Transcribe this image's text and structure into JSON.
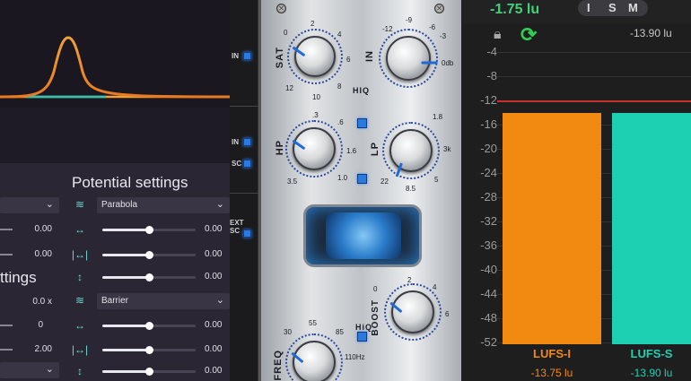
{
  "left": {
    "potential_heading": "Potential settings",
    "settings_heading": "ttings",
    "rows": [
      {
        "left_val": "",
        "select": "Parabola"
      },
      {
        "left_val": "0.00",
        "right_val": "0.00",
        "icon": "arrows-out-icon",
        "slider": 0.55
      },
      {
        "left_val": "0.00",
        "right_val": "0.00",
        "icon": "bracket-arrows-icon",
        "slider": 0.55
      },
      {
        "right_val": "0.00",
        "icon": "vertical-arrows-icon",
        "slider": 0.55
      }
    ],
    "rows2": [
      {
        "left_val": "0.0 x",
        "select": "Barrier"
      },
      {
        "left_val": "0",
        "right_val": "0.00",
        "icon": "arrows-out-icon",
        "slider": 0.55
      },
      {
        "left_val": "2.00",
        "right_val": "0.00",
        "icon": "bracket-arrows-icon",
        "slider": 0.55
      },
      {
        "right_val": "0.00",
        "icon": "vertical-arrows-icon",
        "slider": 0.55
      }
    ],
    "curve_colors": {
      "peak": "#f2a038",
      "base": "#2cc6b8"
    }
  },
  "mid": {
    "strip": [
      "IN",
      "IN",
      "SC",
      "EXT SC"
    ],
    "knobs": {
      "sat": {
        "label": "SAT",
        "ticks": [
          "2",
          "4",
          "6",
          "8",
          "10",
          "12",
          "0"
        ]
      },
      "in": {
        "label": "IN",
        "ticks": [
          "-9",
          "-6",
          "-3",
          "0db",
          "-12"
        ]
      },
      "hp": {
        "label": "HP",
        "ticks": [
          ".3",
          ".6",
          "1.0",
          "1.6",
          "2.6",
          "3.5",
          " .18"
        ]
      },
      "lp": {
        "label": "LP",
        "ticks": [
          "1.8",
          "3k",
          "5",
          "8.5",
          "22",
          "11",
          "6.85"
        ]
      },
      "boost": {
        "label": "BOOST",
        "ticks": [
          "0",
          "2",
          "4",
          "6"
        ]
      },
      "freq": {
        "label": "FREQ",
        "ticks": [
          "55",
          "85",
          "30",
          "110Hz"
        ]
      }
    },
    "hiq_label": "HIQ",
    "boost_hiq": "HiQ"
  },
  "right": {
    "value": "-1.75 lu",
    "btns": [
      "I",
      "S",
      "M"
    ],
    "short_val": "-13.90 lu",
    "axis": [
      "-4",
      "-8",
      "-12",
      "-16",
      "-20",
      "-24",
      "-28",
      "-32",
      "-36",
      "-40",
      "-44",
      "-48",
      "-52"
    ],
    "bars": [
      {
        "label": "LUFS-I",
        "value": "-13.75 lu",
        "color": "#f28a12"
      },
      {
        "label": "LUFS-S",
        "value": "-13.90 lu",
        "color": "#1ed0b2"
      }
    ],
    "colors": {
      "accent": "#43d07a",
      "ref_line": "#c8322a"
    }
  }
}
